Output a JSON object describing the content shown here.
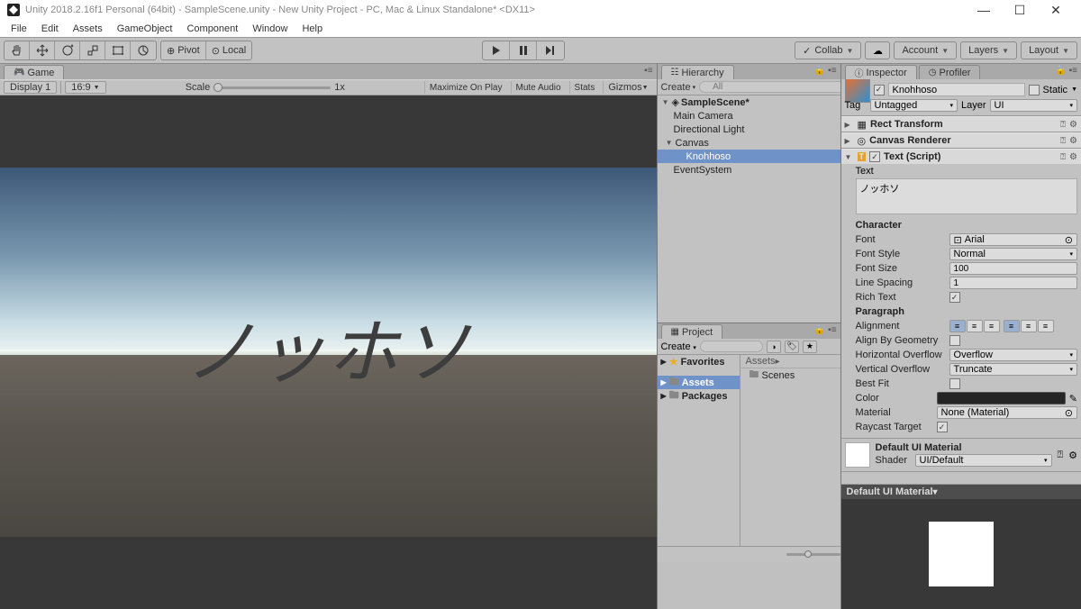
{
  "titlebar": {
    "text": "Unity 2018.2.16f1 Personal (64bit) - SampleScene.unity - New Unity Project - PC, Mac & Linux Standalone* <DX11>"
  },
  "menubar": [
    "File",
    "Edit",
    "Assets",
    "GameObject",
    "Component",
    "Window",
    "Help"
  ],
  "toolbar": {
    "pivot": "Pivot",
    "local": "Local",
    "collab": "Collab",
    "account": "Account",
    "layers": "Layers",
    "layout": "Layout"
  },
  "game_tab": {
    "label": "Game",
    "display": "Display 1",
    "aspect": "16:9",
    "scale_label": "Scale",
    "scale_value": "1x",
    "maximize": "Maximize On Play",
    "mute": "Mute Audio",
    "stats": "Stats",
    "gizmos": "Gizmos"
  },
  "scene_text": "ノッホソ",
  "hierarchy": {
    "tab": "Hierarchy",
    "create": "Create",
    "search_placeholder": "All",
    "scene": "SampleScene*",
    "items": [
      "Main Camera",
      "Directional Light",
      "Canvas",
      "Knohhoso",
      "EventSystem"
    ]
  },
  "project": {
    "tab": "Project",
    "create": "Create",
    "favorites": "Favorites",
    "assets": "Assets",
    "packages": "Packages",
    "crumb": "Assets",
    "scenes": "Scenes"
  },
  "inspector": {
    "tab_inspector": "Inspector",
    "tab_profiler": "Profiler",
    "name": "Knohhoso",
    "static": "Static",
    "tag_label": "Tag",
    "tag_value": "Untagged",
    "layer_label": "Layer",
    "layer_value": "UI",
    "comp_rect": "Rect Transform",
    "comp_canvasr": "Canvas Renderer",
    "comp_text": "Text (Script)",
    "text_label": "Text",
    "text_value": "ノッホソ",
    "character": "Character",
    "font_label": "Font",
    "font_value": "Arial",
    "fontstyle_label": "Font Style",
    "fontstyle_value": "Normal",
    "fontsize_label": "Font Size",
    "fontsize_value": "100",
    "linespacing_label": "Line Spacing",
    "linespacing_value": "1",
    "richtext_label": "Rich Text",
    "paragraph": "Paragraph",
    "alignment_label": "Alignment",
    "alignbygeo_label": "Align By Geometry",
    "hoverflow_label": "Horizontal Overflow",
    "hoverflow_value": "Overflow",
    "voverflow_label": "Vertical Overflow",
    "voverflow_value": "Truncate",
    "bestfit_label": "Best Fit",
    "color_label": "Color",
    "material_label": "Material",
    "material_value": "None (Material)",
    "raycast_label": "Raycast Target",
    "default_mat": "Default UI Material",
    "shader_label": "Shader",
    "shader_value": "UI/Default",
    "preview_title": "Default UI Material"
  }
}
